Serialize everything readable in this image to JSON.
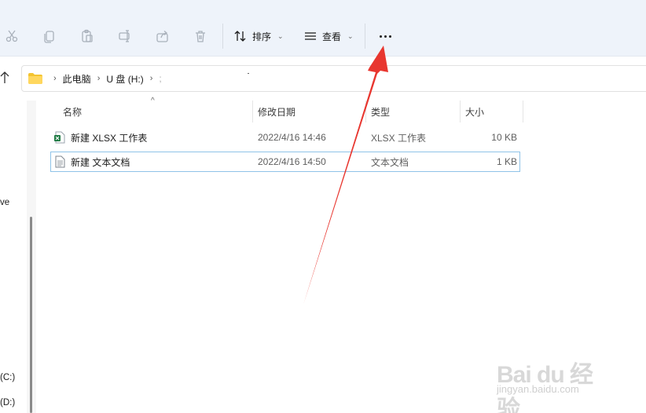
{
  "commandbar": {
    "sort_label": "排序",
    "view_label": "查看"
  },
  "address": {
    "crumbs": [
      "此电脑",
      "U 盘 (H:)",
      ";"
    ]
  },
  "nav": {
    "items": [
      "ve",
      "(C:)",
      "(D:)"
    ]
  },
  "columns": {
    "name": "名称",
    "date": "修改日期",
    "type": "类型",
    "size": "大小"
  },
  "files": [
    {
      "name": "新建 XLSX 工作表",
      "date": "2022/4/16 14:46",
      "type": "XLSX 工作表",
      "size": "10 KB",
      "icon": "excel-file-icon"
    },
    {
      "name": "新建 文本文档",
      "date": "2022/4/16 14:50",
      "type": "文本文档",
      "size": "1 KB",
      "icon": "text-file-icon"
    }
  ],
  "watermark": {
    "main": "Bai du 经验",
    "sub": "jingyan.baidu.com"
  },
  "colors": {
    "annotation_arrow": "#e8362f",
    "selection_border": "#8fc3e8",
    "commandbar_bg": "#eef3fa"
  }
}
